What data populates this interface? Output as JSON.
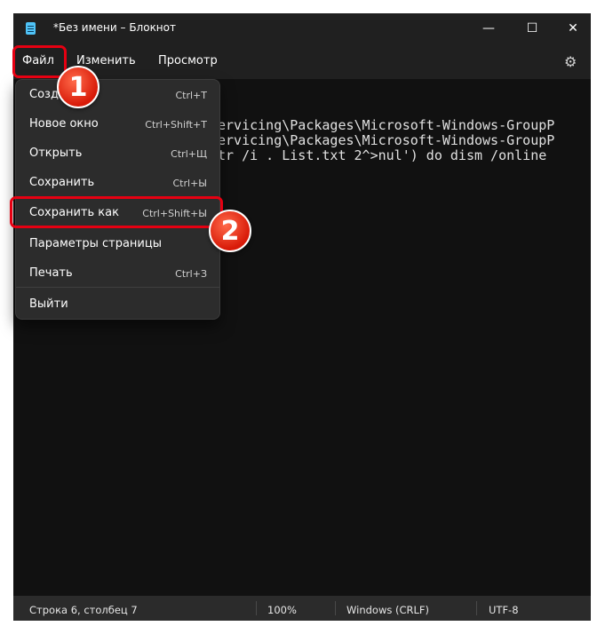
{
  "window": {
    "title": "*Без имени – Блокнот"
  },
  "titlebar": {
    "minimize": "—",
    "maximize": "☐",
    "close": "✕"
  },
  "menubar": {
    "file": "Файл",
    "edit": "Изменить",
    "view": "Просмотр"
  },
  "editor": {
    "lines": [
      "ervicing\\Packages\\Microsoft-Windows-GroupP",
      "ervicing\\Packages\\Microsoft-Windows-GroupP",
      "tr /i . List.txt 2^>nul') do dism /online"
    ]
  },
  "file_menu": {
    "items": [
      {
        "label": "Созда",
        "shortcut": "Ctrl+T"
      },
      {
        "label": "Новое окно",
        "shortcut": "Ctrl+Shift+T"
      },
      {
        "label": "Открыть",
        "shortcut": "Ctrl+Щ"
      },
      {
        "label": "Сохранить",
        "shortcut": "Ctrl+Ы"
      },
      {
        "label": "Сохранить как",
        "shortcut": "Ctrl+Shift+Ы"
      },
      {
        "label": "Параметры страницы",
        "shortcut": ""
      },
      {
        "label": "Печать",
        "shortcut": "Ctrl+З"
      },
      {
        "label": "Выйти",
        "shortcut": ""
      }
    ]
  },
  "statusbar": {
    "position": "Строка 6, столбец 7",
    "zoom": "100%",
    "line_ending": "Windows (CRLF)",
    "encoding": "UTF-8"
  },
  "annotations": {
    "step1": "1",
    "step2": "2",
    "highlight_color": "#e60012"
  }
}
